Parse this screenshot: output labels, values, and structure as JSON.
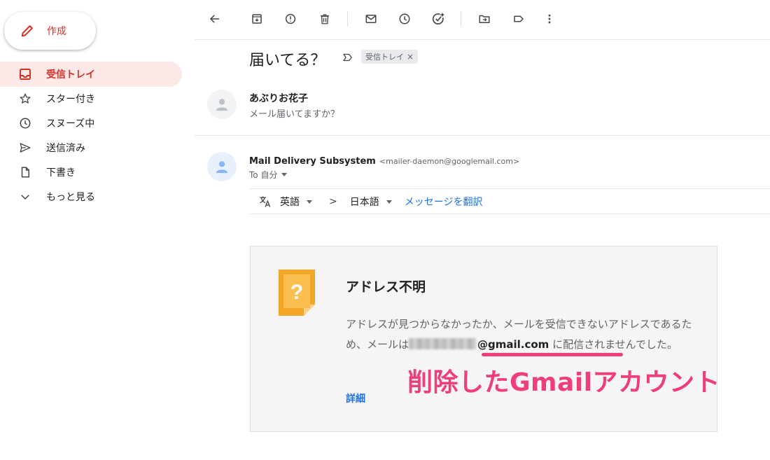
{
  "compose": {
    "label": "作成",
    "icon": "pencil-icon"
  },
  "sidebar": {
    "items": [
      {
        "label": "受信トレイ",
        "icon": "inbox-icon",
        "active": true
      },
      {
        "label": "スター付き",
        "icon": "star-icon"
      },
      {
        "label": "スヌーズ中",
        "icon": "clock-icon"
      },
      {
        "label": "送信済み",
        "icon": "send-icon"
      },
      {
        "label": "下書き",
        "icon": "draft-icon"
      },
      {
        "label": "もっと見る",
        "icon": "chevron-down-icon"
      }
    ]
  },
  "toolbar": {
    "icons": [
      "back-arrow-icon",
      "archive-icon",
      "report-spam-icon",
      "delete-icon",
      "mark-unread-icon",
      "snooze-icon",
      "add-task-icon",
      "move-to-icon",
      "label-icon",
      "more-options-icon"
    ]
  },
  "thread": {
    "subject": "届いてる？",
    "label_chip": "受信トレイ",
    "chip_close": "×"
  },
  "messages": [
    {
      "sender": "あぶりお花子",
      "snippet": "メール届いてますか？"
    },
    {
      "sender": "Mail Delivery Subsystem",
      "email": "<mailer-daemon@googlemail.com>",
      "to": "To 自分"
    }
  ],
  "translate": {
    "from_lang": "英語",
    "arrow": ">",
    "to_lang": "日本語",
    "translate_link": "メッセージを翻訳"
  },
  "bounce": {
    "title": "アドレス不明",
    "body_part1": "アドレスが見つからなかったか、メールを受信できないアドレスであるため、メールは",
    "email_domain": "@gmail.com",
    "body_part2": " に配信されませんでした。",
    "details_link": "詳細",
    "icon": "question-document-icon"
  },
  "annotation": {
    "text": "削除したGmailアカウント",
    "color": "#ee3e7b"
  },
  "colors": {
    "accent_red": "#d93025",
    "active_bg": "#fce8e6",
    "link_blue": "#1a73e8",
    "annotation_pink": "#ee3e7b",
    "card_icon_orange": "#f4a62a"
  }
}
